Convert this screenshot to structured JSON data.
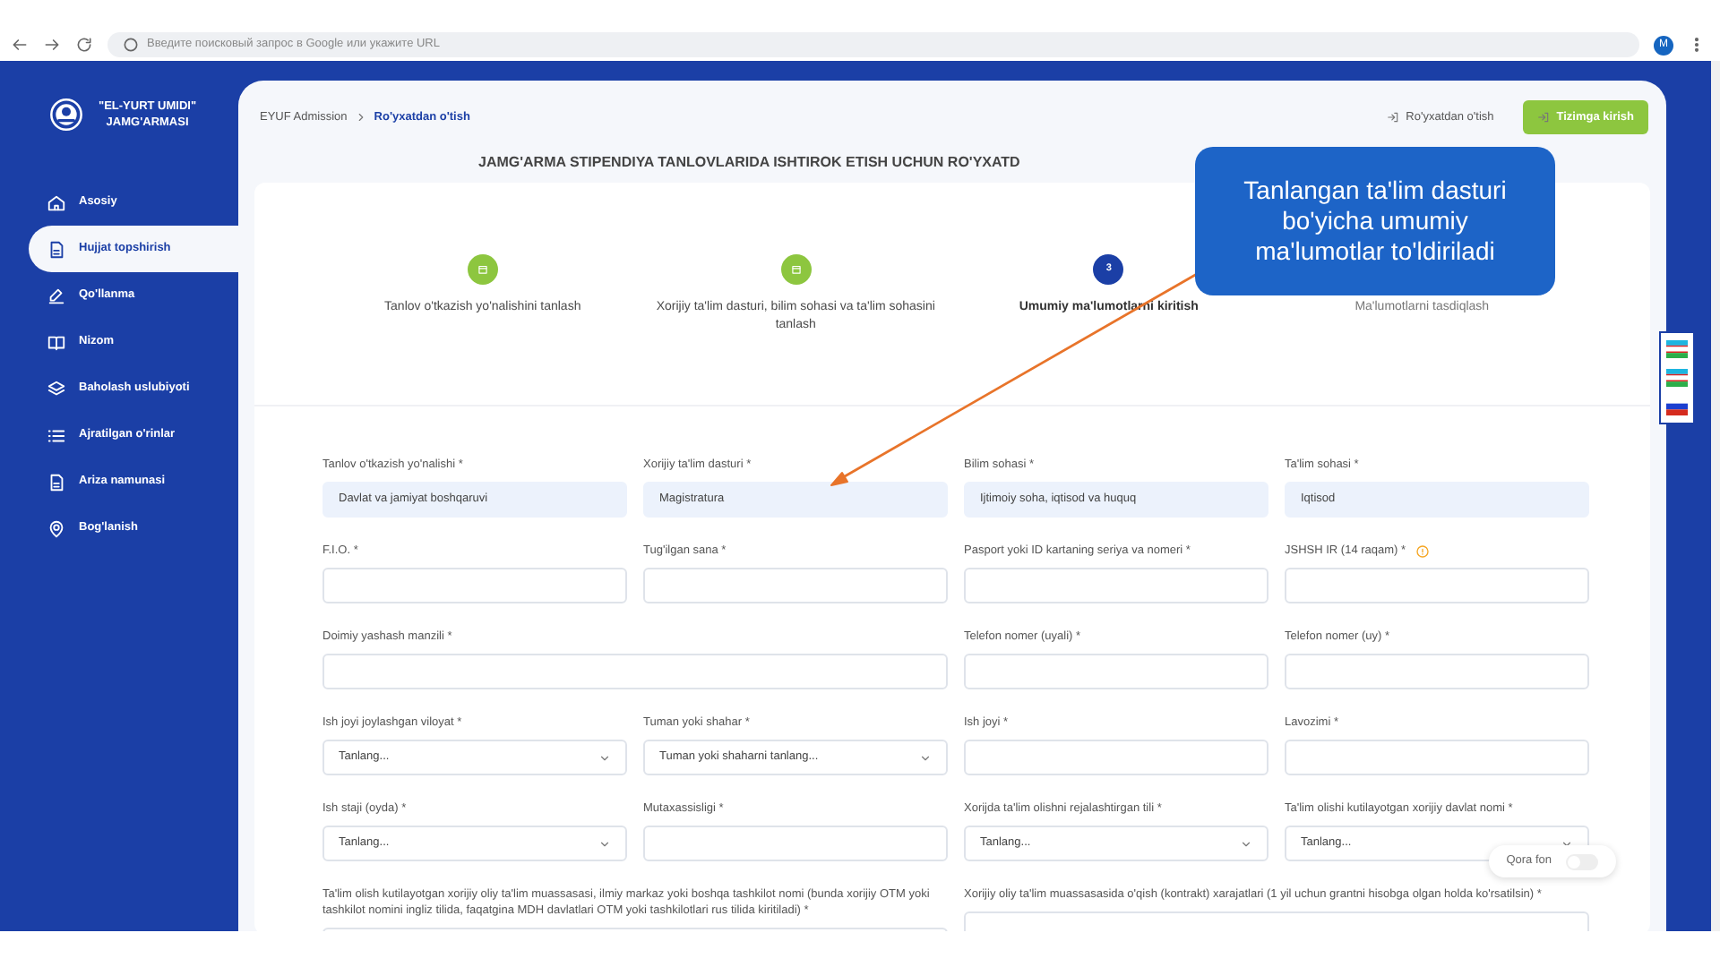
{
  "browser": {
    "address_placeholder": "Введите поисковый запрос в Google или укажите URL",
    "profile": "M"
  },
  "sidebar": {
    "logo_lines": [
      "\"EL-YURT UMIDI\"",
      "JAMG'ARMASI"
    ],
    "items": [
      {
        "label": "Asosiy",
        "selected": false
      },
      {
        "label": "Hujjat topshirish",
        "selected": true
      },
      {
        "label": "Qo'llanma",
        "selected": false
      },
      {
        "label": "Nizom",
        "selected": false
      },
      {
        "label": "Baholash uslubiyoti",
        "selected": false
      },
      {
        "label": "Ajratilgan o'rinlar",
        "selected": false
      },
      {
        "label": "Ariza namunasi",
        "selected": false
      },
      {
        "label": "Bog'lanish",
        "selected": false
      }
    ]
  },
  "breadcrumb": [
    "EYUF Admission",
    "Ro'yxatdan o'tish"
  ],
  "header_links": {
    "register": "Ro'yxatdan o'tish",
    "login": "Tizimga kirish"
  },
  "page_title": "JAMG'ARMA STIPENDIYA TANLOVLARIDA ISHTIROK ETISH UCHUN RO'YXATD",
  "steps": [
    {
      "label": "Tanlov o'tkazish yo'nalishini tanlash",
      "completed": true,
      "selected": false
    },
    {
      "label": "Xorijiy ta'lim dasturi, bilim sohasi va ta'lim sohasini tanlash",
      "completed": true,
      "selected": false
    },
    {
      "label": "Umumiy ma'lumotlarni kiritish",
      "completed": false,
      "selected": true,
      "number": "3"
    },
    {
      "label": "Ma'lumotlarni tasdiqlash",
      "completed": false,
      "selected": false
    }
  ],
  "form": {
    "rows": [
      [
        {
          "label": "Tanlov o'tkazish yo'nalishi *",
          "kind": "text",
          "value": "Davlat va jamiyat boshqaruvi",
          "readonly": true
        },
        {
          "label": "Xorijiy ta'lim dasturi *",
          "kind": "text",
          "value": "Magistratura",
          "readonly": true
        },
        {
          "label": "Bilim sohasi *",
          "kind": "text",
          "value": "Ijtimoiy soha, iqtisod va huquq",
          "readonly": true
        },
        {
          "label": "Ta'lim sohasi *",
          "kind": "text",
          "value": "Iqtisod",
          "readonly": true
        }
      ],
      [
        {
          "label": "F.I.O. *",
          "kind": "text",
          "readonly": false
        },
        {
          "label": "Tug'ilgan sana *",
          "kind": "text",
          "readonly": false
        },
        {
          "label": "Pasport yoki ID kartaning seriya va nomeri *",
          "kind": "text",
          "readonly": false
        },
        {
          "label": "JSHSH IR (14 raqam) *",
          "kind": "text",
          "readonly": false,
          "info": true
        }
      ],
      [
        {
          "label": "Doimiy yashash manzili *",
          "kind": "text",
          "readonly": false
        },
        "",
        {
          "label": "Telefon nomer (uyali) *",
          "kind": "text",
          "readonly": false
        },
        {
          "label": "Telefon nomer (uy) *",
          "kind": "text",
          "readonly": false
        }
      ],
      [
        {
          "label": "Ish joyi joylashgan viloyat *",
          "kind": "select",
          "value": "Tanlang..."
        },
        {
          "label": "Tuman yoki shahar *",
          "kind": "select",
          "value": "Tuman yoki shaharni tanlang..."
        },
        {
          "label": "Ish joyi *",
          "kind": "text",
          "readonly": false
        },
        {
          "label": "Lavozimi *",
          "kind": "text",
          "readonly": false
        }
      ],
      [
        {
          "label": "Ish staji (oyda) *",
          "kind": "select",
          "value": "Tanlang..."
        },
        {
          "label": "Mutaxassisligi *",
          "kind": "text",
          "readonly": false
        },
        {
          "label": "Xorijda ta'lim olishni rejalashtirgan tili *",
          "kind": "select",
          "value": "Tanlang..."
        },
        {
          "label": "Ta'lim olishi kutilayotgan xorijiy davlat nomi *",
          "kind": "select",
          "value": "Tanlang..."
        }
      ],
      [
        {
          "label": "Ta'lim olish kutilayotgan xorijiy oliy ta'lim muassasasi, ilmiy markaz yoki boshqa tashkilot nomi (bunda xorijiy OTM yoki tashkilot nomini ingliz tilida, faqatgina MDH davlatlari OTM yoki tashkilotlari rus tilida kiritiladi) *",
          "kind": "text",
          "readonly": false
        },
        "",
        {
          "label": "Xorijiy oliy ta'lim muassasasida o'qish (kontrakt) xarajatlari (1 yil uchun grantni hisobga olgan holda ko'rsatilsin) *",
          "kind": "text",
          "readonly": false
        },
        ""
      ]
    ]
  },
  "languages": [
    {
      "kind": "uz"
    },
    {
      "kind": "uz"
    },
    {
      "kind": "ru"
    }
  ],
  "dark_mode": {
    "label": "Qora fon",
    "on": false
  },
  "callout": {
    "text": "Tanlangan ta'lim dasturi bo'yicha umumiy ma'lumotlar to'ldiriladi"
  }
}
